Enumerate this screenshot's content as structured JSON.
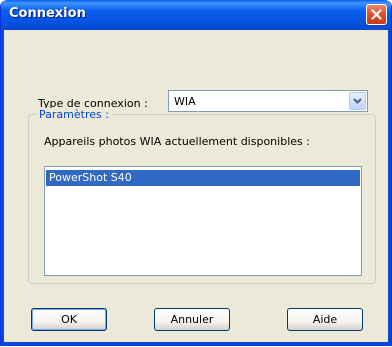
{
  "window": {
    "title": "Connexion"
  },
  "connection": {
    "label": "Type de connexion :",
    "value": "WIA"
  },
  "settings": {
    "group_label": "Paramètres :",
    "available_label": "Appareils photos WIA actuellement disponibles :",
    "devices": [
      "PowerShot S40"
    ],
    "selected_device": "PowerShot S40"
  },
  "buttons": {
    "ok": "OK",
    "cancel": "Annuler",
    "help": "Aide"
  },
  "icons": {
    "close": "close-icon",
    "dropdown": "chevron-down-icon"
  },
  "colors": {
    "titlebar": "#0a5fec",
    "selection": "#316ac5",
    "group_label": "#0046d5",
    "close_button": "#e0522d"
  }
}
